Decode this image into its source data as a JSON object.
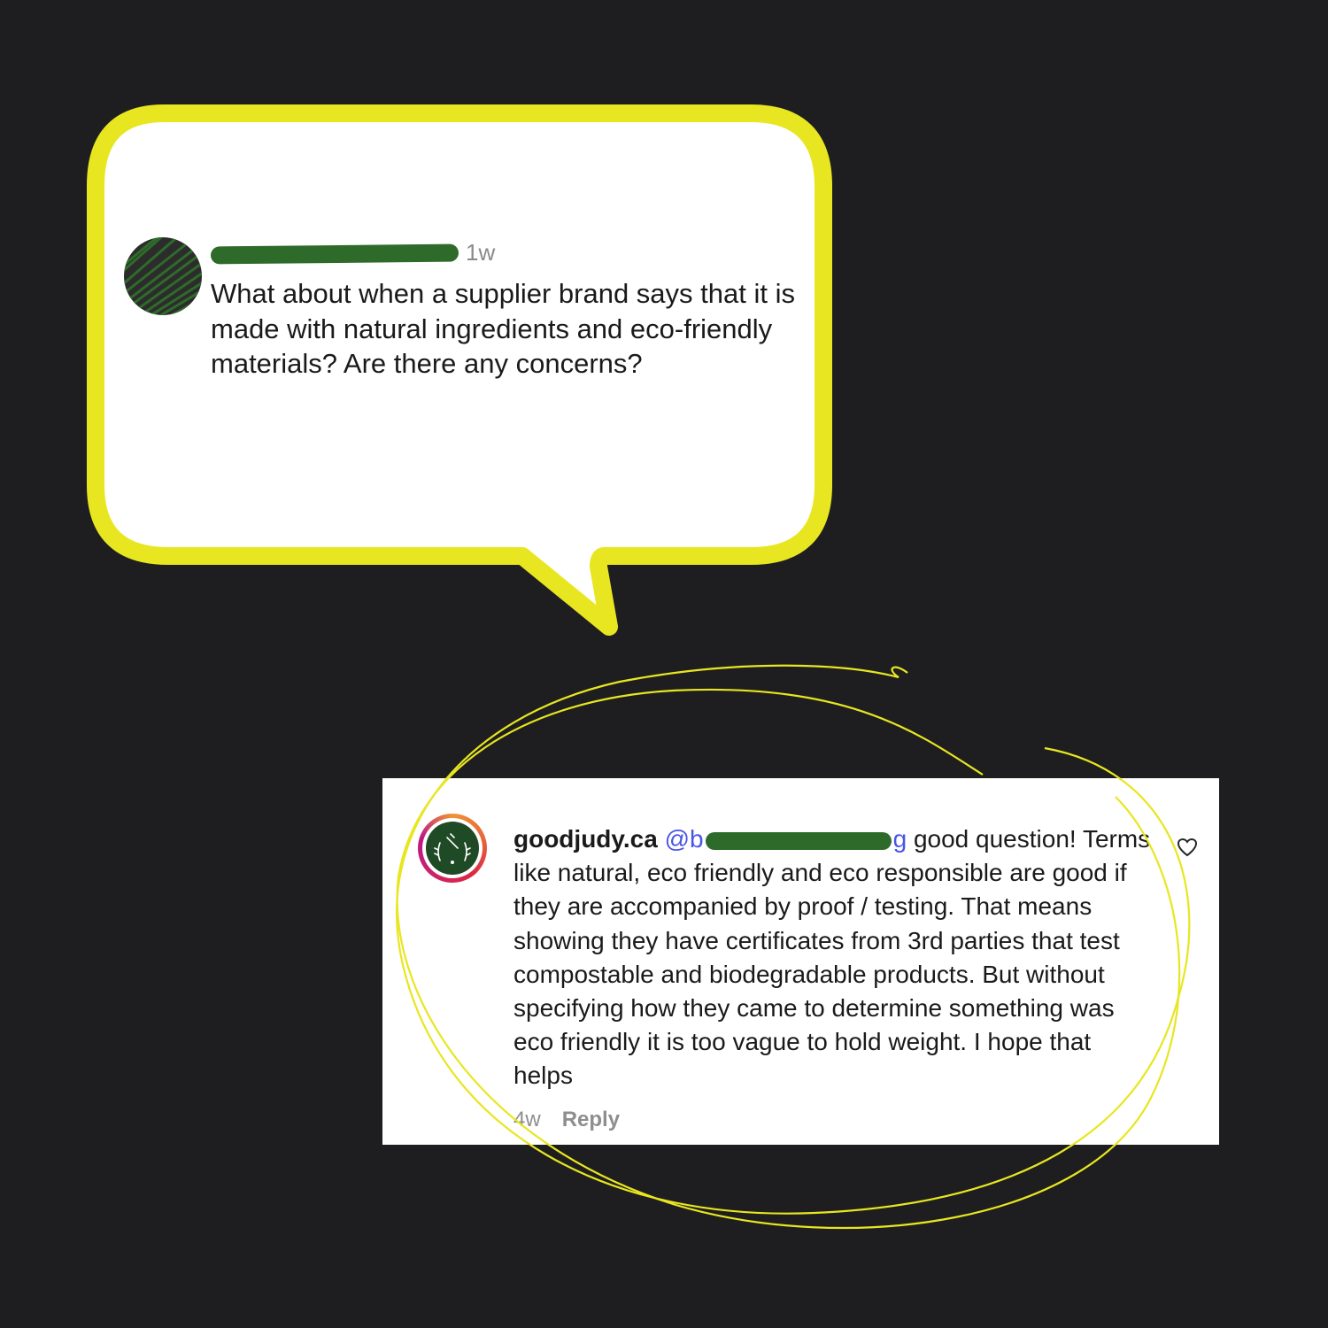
{
  "question": {
    "time": "1w",
    "text": "What about when a supplier brand says that it is made with natural ingredients and eco-friendly materials? Are there any concerns?"
  },
  "reply": {
    "username": "goodjudy.ca",
    "mention_prefix": "@b",
    "mention_suffix": "g",
    "text": "good question! Terms like natural, eco friendly and eco responsible are good if they are accompanied by proof / testing. That means showing they have certificates from 3rd parties that test compostable and biodegradable products. But without specifying how they came to determine something was eco friendly it is too vague to hold weight. I hope that helps",
    "time": "4w",
    "reply_label": "Reply",
    "like_icon": "heart-icon"
  },
  "colors": {
    "background": "#1e1e20",
    "bubble_border": "#e8e620",
    "annotation": "#e8e620",
    "redaction": "#2e6b2a",
    "mention": "#4a55e6"
  }
}
